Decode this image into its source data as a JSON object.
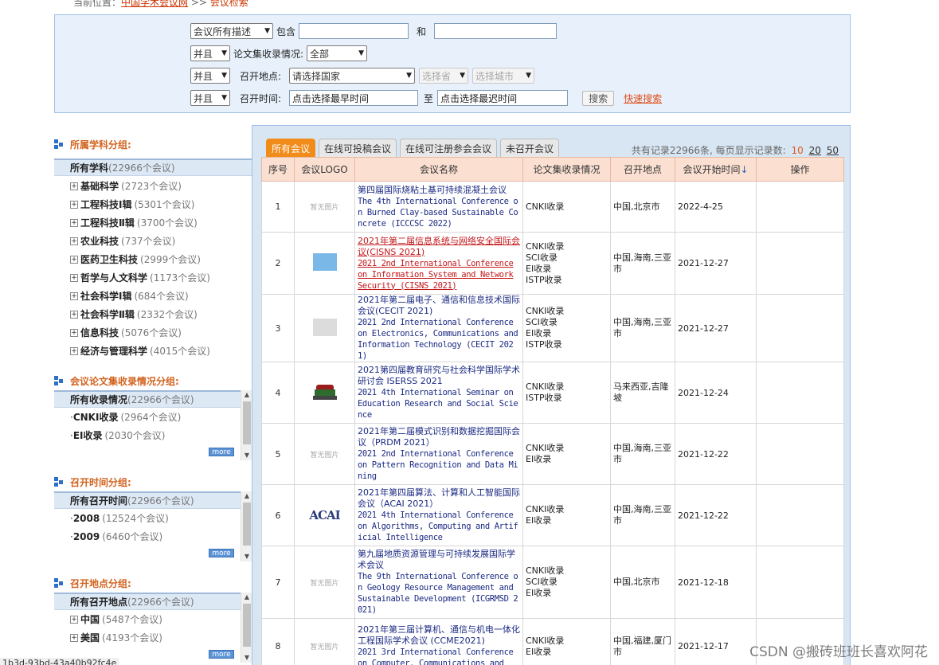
{
  "breadcrumb": {
    "prefix": "当前位置：",
    "home": "中国学术会议网",
    "sep": " >> ",
    "current": "会议检索"
  },
  "search": {
    "field_select": "会议所有描述",
    "contains_label": "包含",
    "and_label": "和",
    "logic1": "并且",
    "collection_label": "论文集收录情况:",
    "collection_select": "全部",
    "logic2": "并且",
    "location_label": "召开地点:",
    "country_select": "请选择国家",
    "province_select": "选择省",
    "city_select": "选择城市",
    "logic3": "并且",
    "time_label": "召开时间:",
    "start_placeholder": "点击选择最早时间",
    "to_label": "至",
    "end_placeholder": "点击选择最迟时间",
    "search_button": "搜索",
    "quick_search": "快速搜索"
  },
  "sidebar": {
    "subject": {
      "title": "所属学科分组:",
      "head": "所有学科",
      "head_count": "(22966个会议)",
      "items": [
        {
          "label": "基础科学",
          "count": "(2723个会议)"
        },
        {
          "label": "工程科技Ⅰ辑",
          "count": "(5301个会议)"
        },
        {
          "label": "工程科技Ⅱ辑",
          "count": "(3700个会议)"
        },
        {
          "label": "农业科技",
          "count": "(737个会议)"
        },
        {
          "label": "医药卫生科技",
          "count": "(2999个会议)"
        },
        {
          "label": "哲学与人文科学",
          "count": "(1173个会议)"
        },
        {
          "label": "社会科学Ⅰ辑",
          "count": "(684个会议)"
        },
        {
          "label": "社会科学Ⅱ辑",
          "count": "(2332个会议)"
        },
        {
          "label": "信息科技",
          "count": "(5076个会议)"
        },
        {
          "label": "经济与管理科学",
          "count": "(4015个会议)"
        }
      ]
    },
    "collection": {
      "title": "会议论文集收录情况分组:",
      "head": "所有收录情况",
      "head_count": "(22966个会议)",
      "items": [
        {
          "label": "CNKI收录",
          "count": "(2964个会议)"
        },
        {
          "label": "EI收录",
          "count": "(2030个会议)"
        }
      ],
      "more": "more"
    },
    "time": {
      "title": "召开时间分组:",
      "head": "所有召开时间",
      "head_count": "(22966个会议)",
      "items": [
        {
          "label": "2008",
          "count": "(12524个会议)"
        },
        {
          "label": "2009",
          "count": "(6460个会议)"
        }
      ],
      "more": "more"
    },
    "place": {
      "title": "召开地点分组:",
      "head": "所有召开地点",
      "head_count": "(22966个会议)",
      "items": [
        {
          "label": "中国",
          "count": "(5487个会议)"
        },
        {
          "label": "美国",
          "count": "(4193个会议)"
        }
      ],
      "more": "more"
    }
  },
  "tabs": [
    "所有会议",
    "在线可投稿会议",
    "在线可注册参会会议",
    "未召开会议"
  ],
  "records": {
    "text": "共有记录22966条, 每页显示记录数:",
    "page_sizes": [
      "10",
      "20",
      "50"
    ]
  },
  "table": {
    "headers": [
      "序号",
      "会议LOGO",
      "会议名称",
      "论文集收录情况",
      "召开地点",
      "会议开始时间",
      "操作"
    ],
    "sort_arrow": "↓",
    "no_image": "暂无图片",
    "rows": [
      {
        "no": "1",
        "logo": "none",
        "cn": "第四届国际烧粘土基可持续混凝土会议",
        "en": "The 4th International Conference on Burned Clay-based Sustainable Concrete (ICCCSC 2022)",
        "index": [
          "CNKI收录"
        ],
        "loc": "中国,北京市",
        "date": "2022-4-25",
        "hl": false
      },
      {
        "no": "2",
        "logo": "blue",
        "cn": "2021年第二届信息系统与网络安全国际会议(CISNS 2021)",
        "en": "2021 2nd International Conference on Information System and Network Security (CISNS 2021)",
        "index": [
          "CNKI收录",
          "SCI收录",
          "EI收录",
          "ISTP收录"
        ],
        "loc": "中国,海南,三亚市",
        "date": "2021-12-27",
        "hl": true
      },
      {
        "no": "3",
        "logo": "gray",
        "cn": "2021年第二届电子、通信和信息技术国际会议(CECIT 2021)",
        "en": "2021 2nd International Conference on Electronics, Communications and Information Technology (CECIT 2021)",
        "index": [
          "CNKI收录",
          "SCI收录",
          "EI收录",
          "ISTP收录"
        ],
        "loc": "中国,海南,三亚市",
        "date": "2021-12-27",
        "hl": false
      },
      {
        "no": "4",
        "logo": "train",
        "cn": "2021第四届教育研究与社会科学国际学术研讨会 ISERSS 2021",
        "en": "2021 4th International Seminar on Education Research and Social Science",
        "index": [
          "CNKI收录",
          "ISTP收录"
        ],
        "loc": "马来西亚,吉隆坡",
        "date": "2021-12-24",
        "hl": false
      },
      {
        "no": "5",
        "logo": "none",
        "cn": "2021年第二届模式识别和数据挖掘国际会议（PRDM 2021）",
        "en": "2021 2nd International Conference on Pattern Recognition and Data Mining",
        "index": [
          "CNKI收录",
          "EI收录"
        ],
        "loc": "中国,海南,三亚市",
        "date": "2021-12-22",
        "hl": false
      },
      {
        "no": "6",
        "logo": "acai",
        "logo_text": "ACAI",
        "cn": "2021年第四届算法、计算和人工智能国际会议（ACAI 2021）",
        "en": "2021 4th International Conference on Algorithms, Computing and Artificial Intelligence",
        "index": [
          "CNKI收录",
          "EI收录"
        ],
        "loc": "中国,海南,三亚市",
        "date": "2021-12-22",
        "hl": false
      },
      {
        "no": "7",
        "logo": "none",
        "cn": "第九届地质资源管理与可持续发展国际学术会议",
        "en": "The 9th International Conference on Geology Resource Management and Sustainable Development (ICGRMSD 2021)",
        "index": [
          "CNKI收录",
          "SCI收录",
          "EI收录"
        ],
        "loc": "中国,北京市",
        "date": "2021-12-18",
        "hl": false
      },
      {
        "no": "8",
        "logo": "none",
        "cn": "2021年第三届计算机、通信与机电一体化工程国际学术会议 (CCME2021)",
        "en": "2021 3rd International Conference on Computer, Communications and",
        "index": [
          "CNKI收录",
          "EI收录"
        ],
        "loc": "中国,福建,厦门市",
        "date": "2021-12-17",
        "hl": false
      }
    ]
  },
  "watermark": "CSDN @搬砖班班长喜欢阿花",
  "bottom_fragment": "1b3d-93bd-43a40b92fc4e"
}
